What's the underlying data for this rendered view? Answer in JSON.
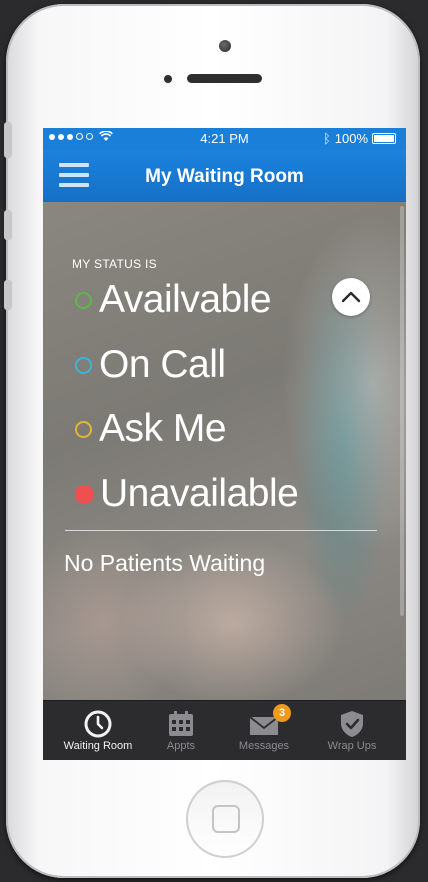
{
  "status_bar": {
    "time": "4:21 PM",
    "battery": "100%",
    "bluetooth_icon": "ᛒ"
  },
  "navbar": {
    "title": "My Waiting Room",
    "menu_icon": "hamburger-menu-icon"
  },
  "status_panel": {
    "label": "MY STATUS IS",
    "options": [
      {
        "label": "Availvable",
        "color": "#5cb84a",
        "style": "ring"
      },
      {
        "label": "On Call",
        "color": "#3fb3d8",
        "style": "ring"
      },
      {
        "label": "Ask Me",
        "color": "#e1b43a",
        "style": "ring"
      },
      {
        "label": "Unavailable",
        "color": "#ef4f4f",
        "style": "filled"
      }
    ],
    "collapse_icon": "chevron-up-icon"
  },
  "waiting": {
    "text": "No Patients Waiting"
  },
  "tab_bar": {
    "tabs": [
      {
        "label": "Waiting Room",
        "icon": "clock-icon",
        "active": true
      },
      {
        "label": "Appts",
        "icon": "calendar-icon",
        "active": false
      },
      {
        "label": "Messages",
        "icon": "envelope-icon",
        "active": false,
        "badge": "3"
      },
      {
        "label": "Wrap Ups",
        "icon": "shield-check-icon",
        "active": false
      }
    ]
  },
  "colors": {
    "accent": "#1a7fd8",
    "tab_bar": "#2c2c2e",
    "badge": "#f09a1a"
  }
}
